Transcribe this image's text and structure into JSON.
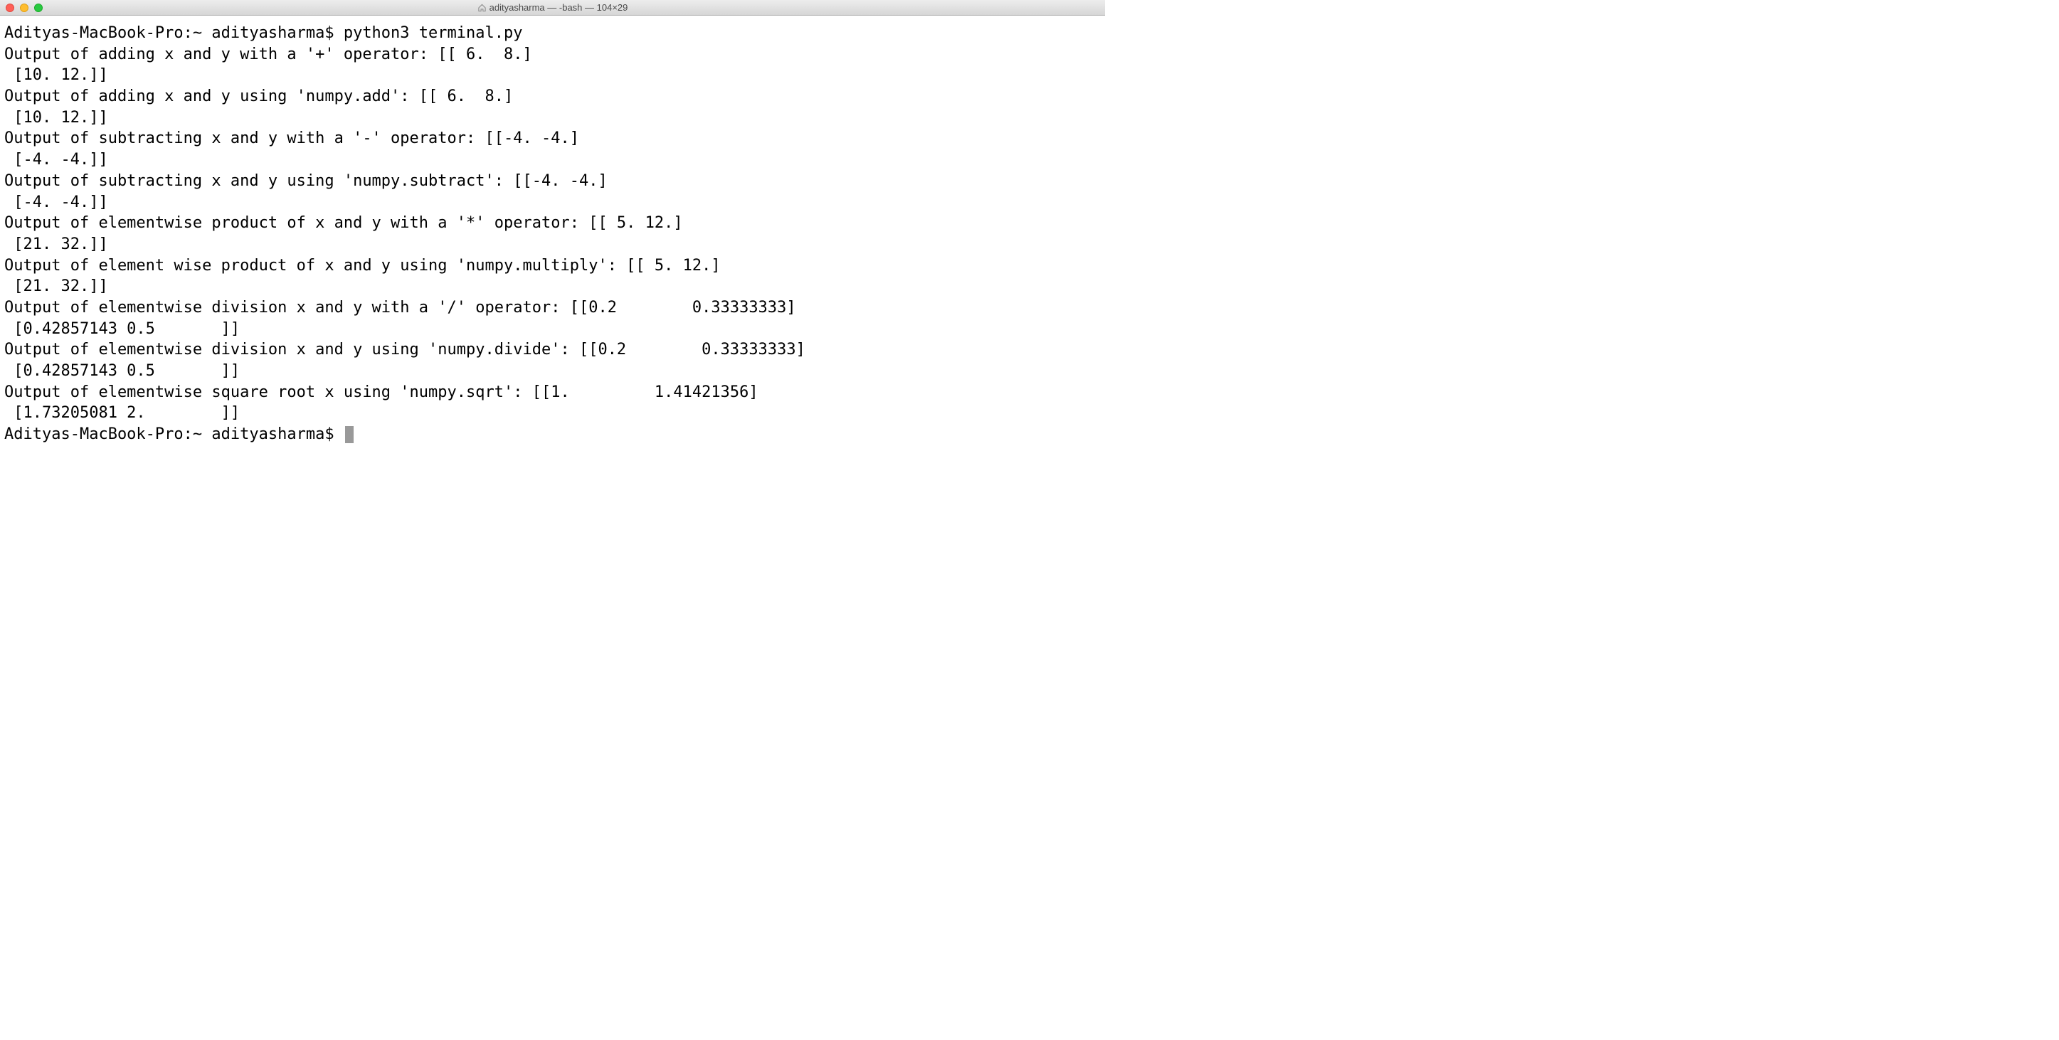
{
  "titlebar": {
    "title": "adityasharma — -bash — 104×29"
  },
  "terminal": {
    "prompt1": "Adityas-MacBook-Pro:~ adityasharma$ python3 terminal.py",
    "lines": [
      "Output of adding x and y with a '+' operator: [[ 6.  8.]",
      " [10. 12.]]",
      "Output of adding x and y using 'numpy.add': [[ 6.  8.]",
      " [10. 12.]]",
      "Output of subtracting x and y with a '-' operator: [[-4. -4.]",
      " [-4. -4.]]",
      "Output of subtracting x and y using 'numpy.subtract': [[-4. -4.]",
      " [-4. -4.]]",
      "Output of elementwise product of x and y with a '*' operator: [[ 5. 12.]",
      " [21. 32.]]",
      "Output of element wise product of x and y using 'numpy.multiply': [[ 5. 12.]",
      " [21. 32.]]",
      "Output of elementwise division x and y with a '/' operator: [[0.2        0.33333333]",
      " [0.42857143 0.5       ]]",
      "Output of elementwise division x and y using 'numpy.divide': [[0.2        0.33333333]",
      " [0.42857143 0.5       ]]",
      "Output of elementwise square root x using 'numpy.sqrt': [[1.         1.41421356]",
      " [1.73205081 2.        ]]"
    ],
    "prompt2": "Adityas-MacBook-Pro:~ adityasharma$ "
  }
}
